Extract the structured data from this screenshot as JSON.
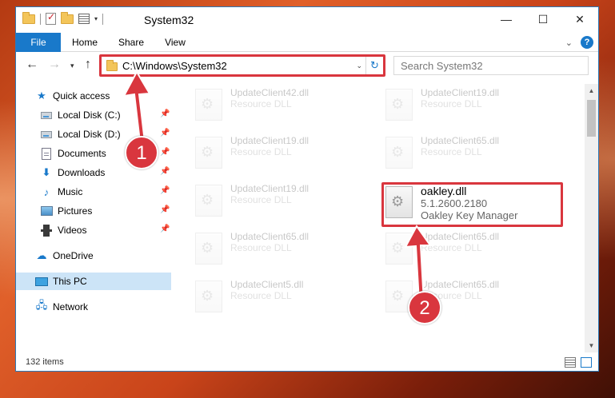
{
  "window": {
    "title": "System32",
    "controls": {
      "minimize": "—",
      "maximize": "☐",
      "close": "✕"
    }
  },
  "ribbon": {
    "tabs": [
      "File",
      "Home",
      "Share",
      "View"
    ]
  },
  "nav": {
    "address": "C:\\Windows\\System32",
    "search_placeholder": "Search System32"
  },
  "sidebar": {
    "items": [
      {
        "label": "Quick access",
        "icon": "star-icon",
        "pinned": false
      },
      {
        "label": "Local Disk (C:)",
        "icon": "drive-icon",
        "pinned": true
      },
      {
        "label": "Local Disk (D:)",
        "icon": "drive-icon",
        "pinned": true
      },
      {
        "label": "Documents",
        "icon": "documents-icon",
        "pinned": true
      },
      {
        "label": "Downloads",
        "icon": "download-icon",
        "pinned": true
      },
      {
        "label": "Music",
        "icon": "music-icon",
        "pinned": true
      },
      {
        "label": "Pictures",
        "icon": "pictures-icon",
        "pinned": true
      },
      {
        "label": "Videos",
        "icon": "videos-icon",
        "pinned": true
      },
      {
        "label": "OneDrive",
        "icon": "cloud-icon",
        "pinned": false
      },
      {
        "label": "This PC",
        "icon": "computer-icon",
        "pinned": false,
        "selected": true
      },
      {
        "label": "Network",
        "icon": "network-icon",
        "pinned": false
      }
    ]
  },
  "files": {
    "left": [
      {
        "name": "UpdateClient42.dll",
        "type": "Resource DLL"
      },
      {
        "name": "UpdateClient19.dll",
        "type": "Resource DLL"
      },
      {
        "name": "UpdateClient19.dll",
        "type": "Resource DLL"
      },
      {
        "name": "UpdateClient65.dll",
        "type": "Resource DLL"
      },
      {
        "name": "UpdateClient5.dll",
        "type": "Resource DLL"
      }
    ],
    "right": [
      {
        "name": "UpdateClient19.dll",
        "type": "Resource DLL"
      },
      {
        "name": "UpdateClient65.dll",
        "type": "Resource DLL"
      },
      {
        "name": "UpdateClient65.dll",
        "type": "Resource DLL"
      },
      {
        "name": "UpdateClient65.dll",
        "type": "Resource DLL"
      }
    ],
    "highlighted": {
      "name": "oakley.dll",
      "version": "5.1.2600.2180",
      "description": "Oakley Key Manager"
    }
  },
  "status": {
    "item_count": "132 items"
  },
  "annotations": {
    "step1": "1",
    "step2": "2",
    "highlight_color": "#d9363e"
  }
}
